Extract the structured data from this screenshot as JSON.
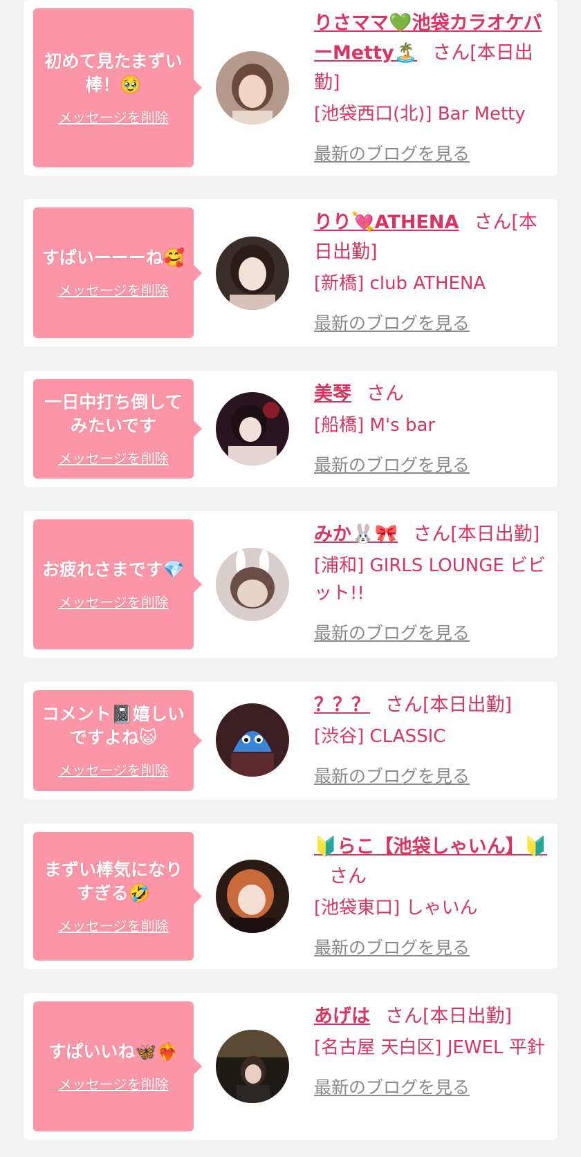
{
  "delete_label": "メッセージを削除",
  "blog_label": "最新のブログを見る",
  "colors": {
    "background": "#f2f2f2",
    "card": "#ffffff",
    "bubble": "#fd97a7",
    "accent": "#d8345f",
    "link_gray": "#8a8a8a"
  },
  "entries": [
    {
      "message": "初めて見たまずい棒！🥹",
      "name": "りさママ💚池袋カラオケバーMetty🏝️",
      "suffix": "さん[本日出勤]",
      "shop": "[池袋西口(北)] Bar Metty",
      "avatar_icon": "profile-photo-icon"
    },
    {
      "message": "すぱいーーーね🥰",
      "name": "りり💘ATHENA",
      "suffix": "さん[本日出勤]",
      "shop": "[新橋] club ATHENA",
      "avatar_icon": "profile-photo-icon"
    },
    {
      "message": "一日中打ち倒してみたいです",
      "name": "美琴",
      "suffix": "さん",
      "shop": "[船橋] M's bar",
      "avatar_icon": "profile-photo-icon"
    },
    {
      "message": "お疲れさまです💎",
      "name": "みか🐰🎀",
      "suffix": "さん[本日出勤]",
      "shop": "[浦和] GIRLS LOUNGE ビビット!!",
      "avatar_icon": "profile-photo-icon"
    },
    {
      "message": "コメント📓嬉しいですよね😺",
      "name": "？？？",
      "suffix": "さん[本日出勤]",
      "shop": "[渋谷] CLASSIC",
      "avatar_icon": "profile-photo-icon"
    },
    {
      "message": "まずい棒気になりすぎる🤣",
      "name": "🔰らこ【池袋しゃいん】🔰",
      "suffix": "さん",
      "shop": "[池袋東口] しゃいん",
      "avatar_icon": "profile-photo-icon"
    },
    {
      "message": "すぱいいね🦋❤️‍🔥",
      "name": "あげは",
      "suffix": "さん[本日出勤]",
      "shop": "[名古屋 天白区] JEWEL 平針",
      "avatar_icon": "profile-photo-icon"
    }
  ]
}
